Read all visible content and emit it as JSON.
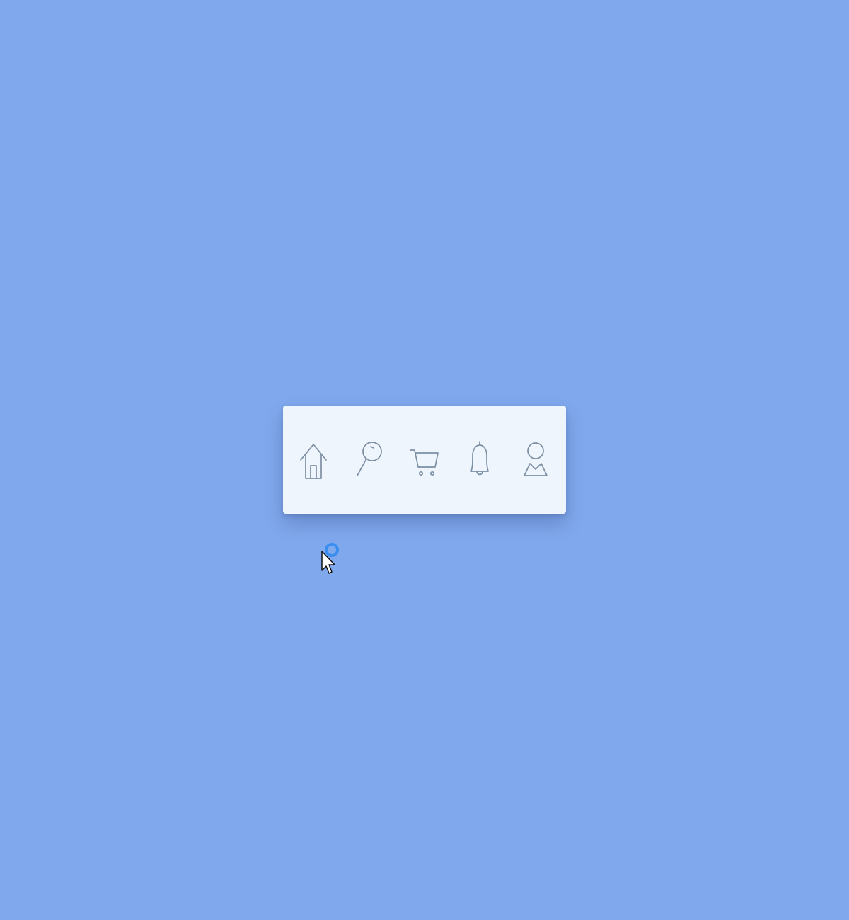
{
  "colors": {
    "background": "#80a8ec",
    "navbar_background": "#eef5fd",
    "icon_stroke": "#7d8fa2",
    "click_ring": "#3a8ef0"
  },
  "navbar": {
    "items": [
      {
        "icon": "home-icon"
      },
      {
        "icon": "search-icon"
      },
      {
        "icon": "cart-icon"
      },
      {
        "icon": "bell-icon"
      },
      {
        "icon": "user-icon"
      }
    ]
  },
  "cursor": {
    "icon": "mouse-pointer-icon",
    "click_indicator": "click-ring"
  }
}
